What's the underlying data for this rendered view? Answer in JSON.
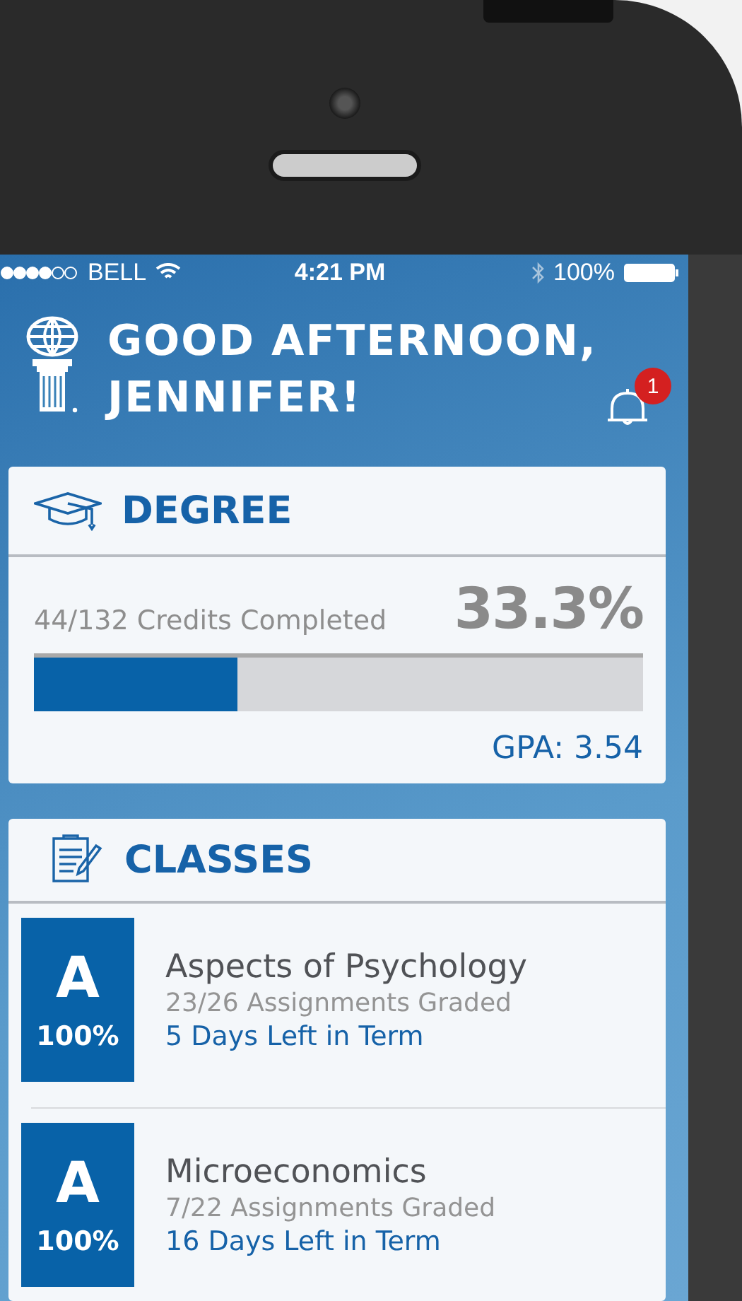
{
  "status_bar": {
    "carrier": "BELL",
    "time": "4:21 PM",
    "battery": "100%"
  },
  "header": {
    "greeting": "GOOD AFTERNOON,\nJENNIFER!",
    "notification_count": "1"
  },
  "degree": {
    "title": "DEGREE",
    "credits": "44/132 Credits Completed",
    "percent": "33.3%",
    "level": 0.333,
    "gpa": "GPA: 3.54"
  },
  "classes": {
    "title": "CLASSES",
    "items": [
      {
        "grade": "A",
        "percent": "100%",
        "name": "Aspects of Psychology",
        "assignments": "23/26 Assignments Graded",
        "days_left": "5 Days Left in Term"
      },
      {
        "grade": "A",
        "percent": "100%",
        "name": "Microeconomics",
        "assignments": "7/22 Assignments Graded",
        "days_left": "16 Days Left in Term"
      }
    ]
  }
}
